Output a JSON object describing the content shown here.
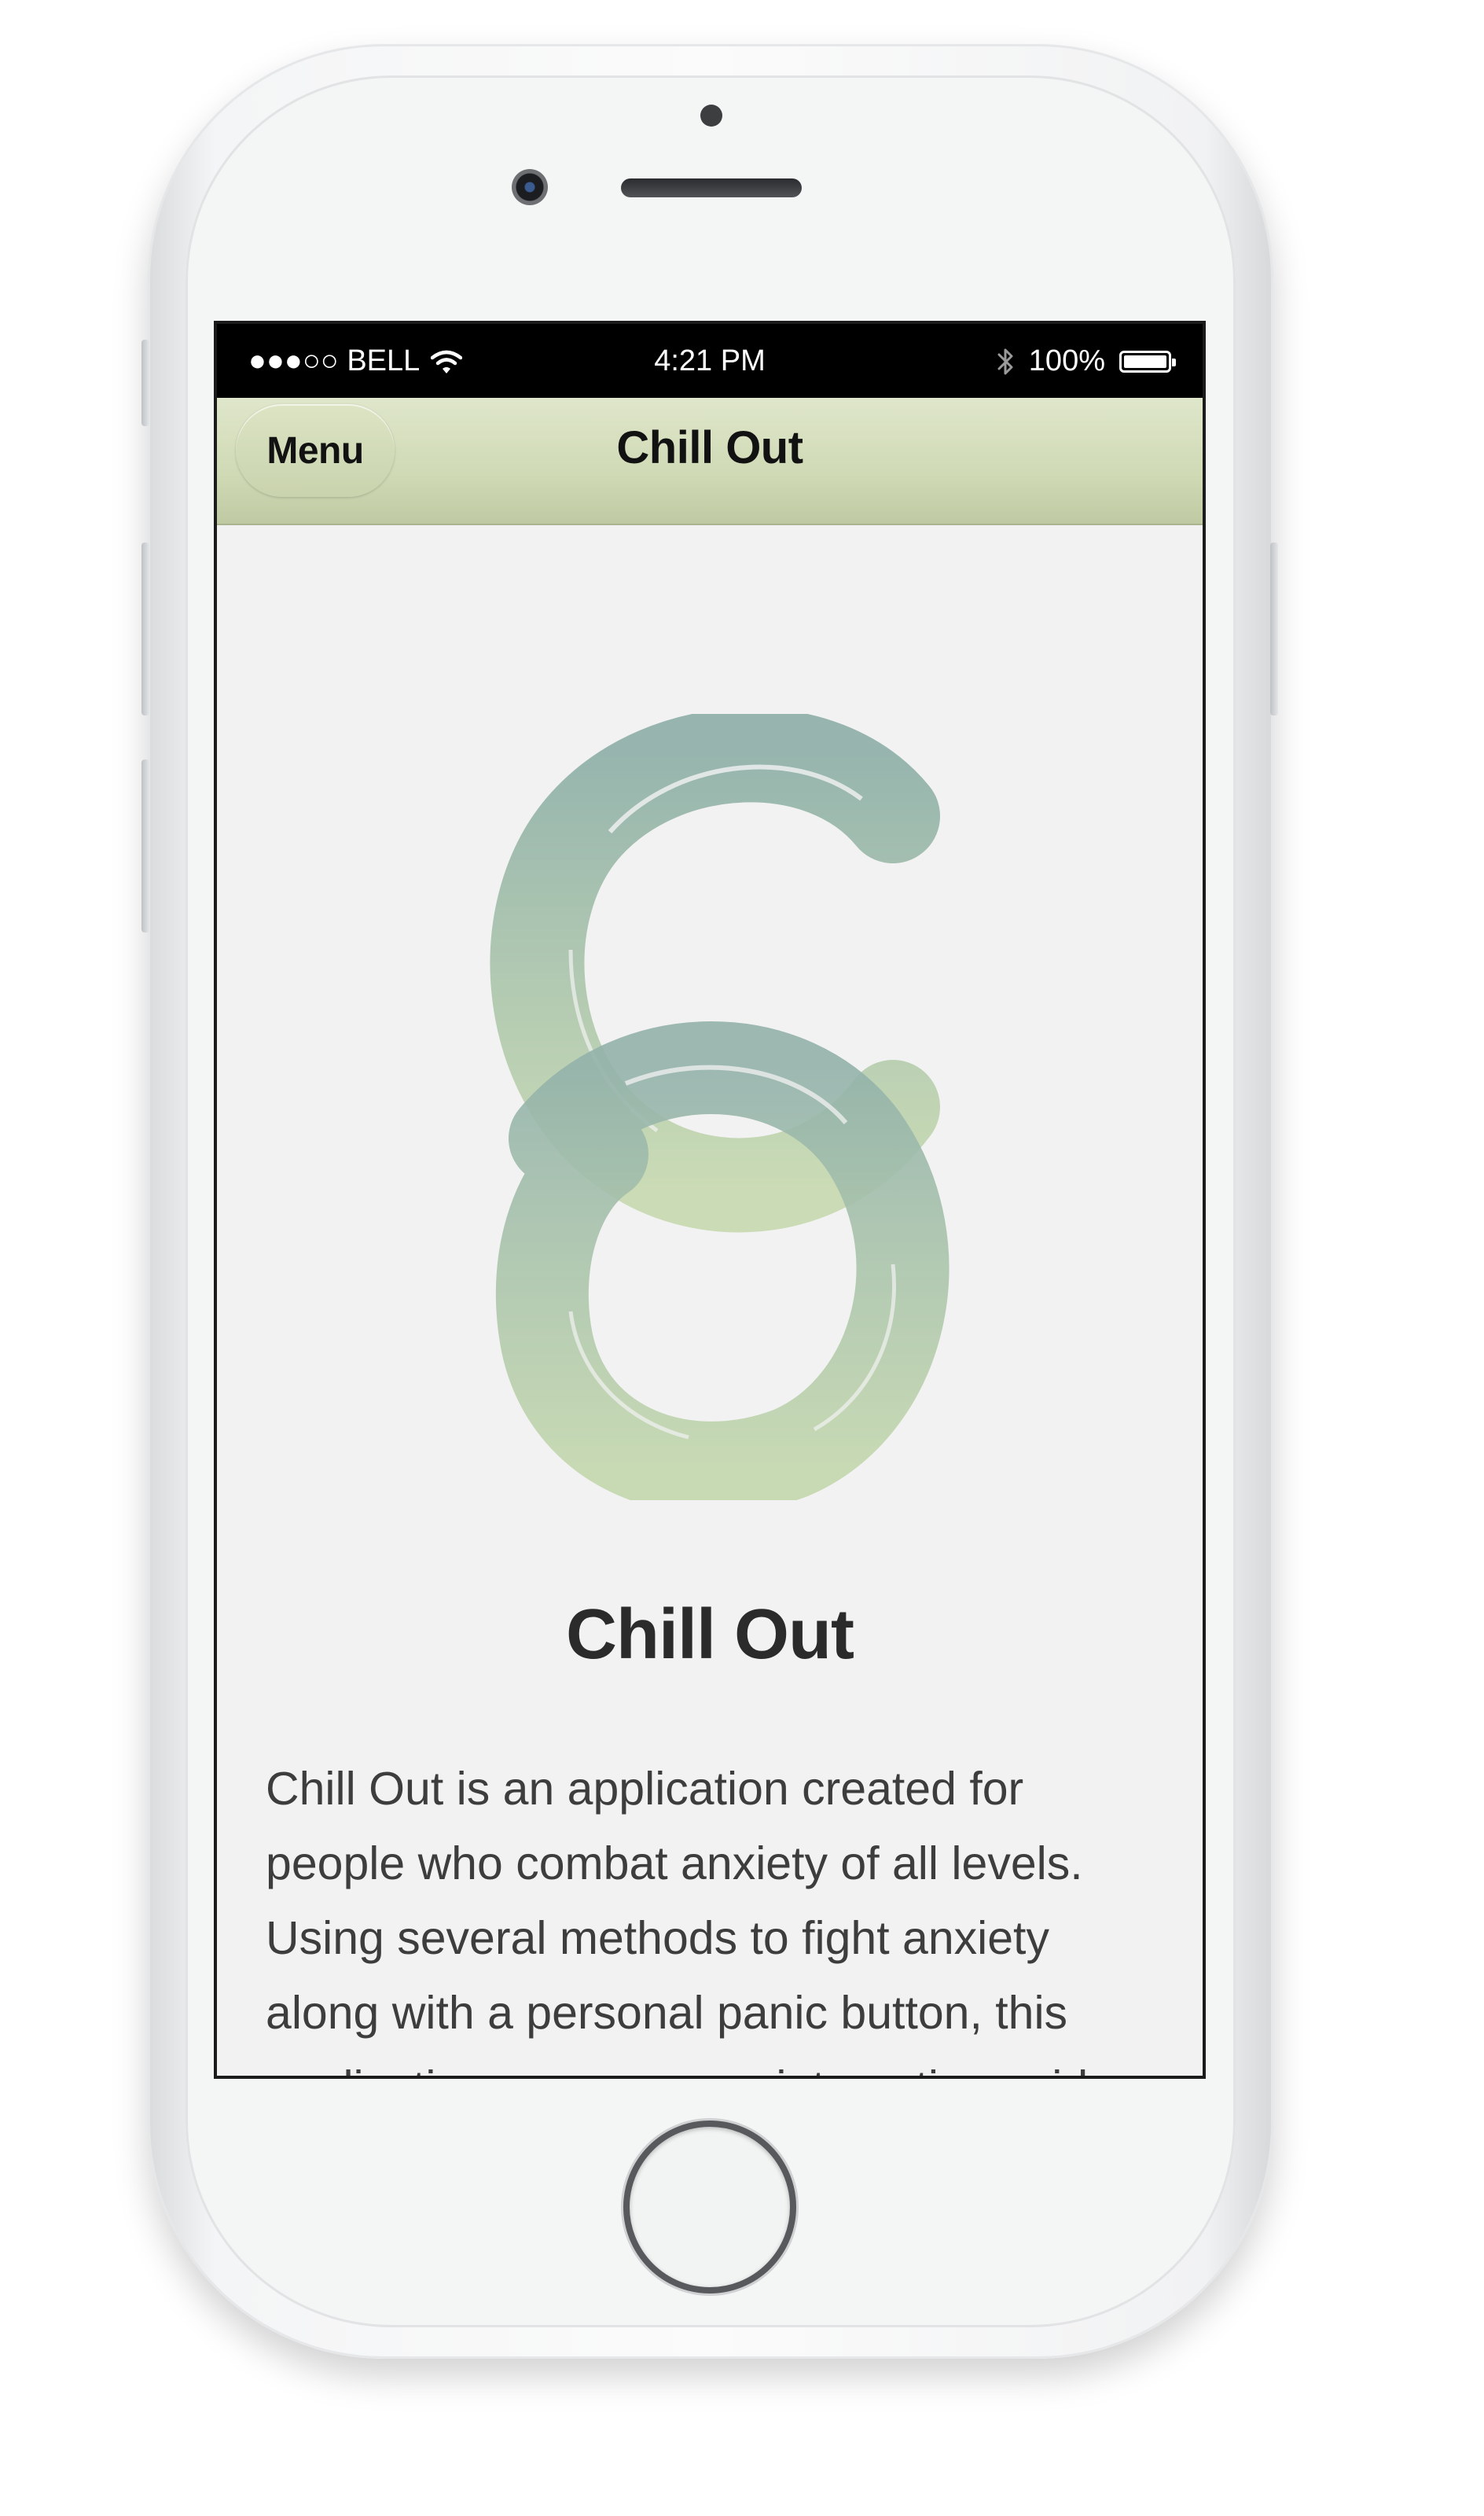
{
  "status_bar": {
    "carrier": "●●●○○ BELL",
    "time": "4:21 PM",
    "battery": "100%"
  },
  "nav": {
    "menu_label": "Menu",
    "title": "Chill Out"
  },
  "main": {
    "title": "Chill Out",
    "description": "Chill Out is an application created for people who combat anxiety of all levels. Using several methods to fight anxiety along with a personal panic button, this application serves as an interactive guide"
  },
  "colors": {
    "nav_bar": "#d0dab5",
    "logo_top": "#8fb0a8",
    "logo_bottom": "#c6d9b0"
  }
}
